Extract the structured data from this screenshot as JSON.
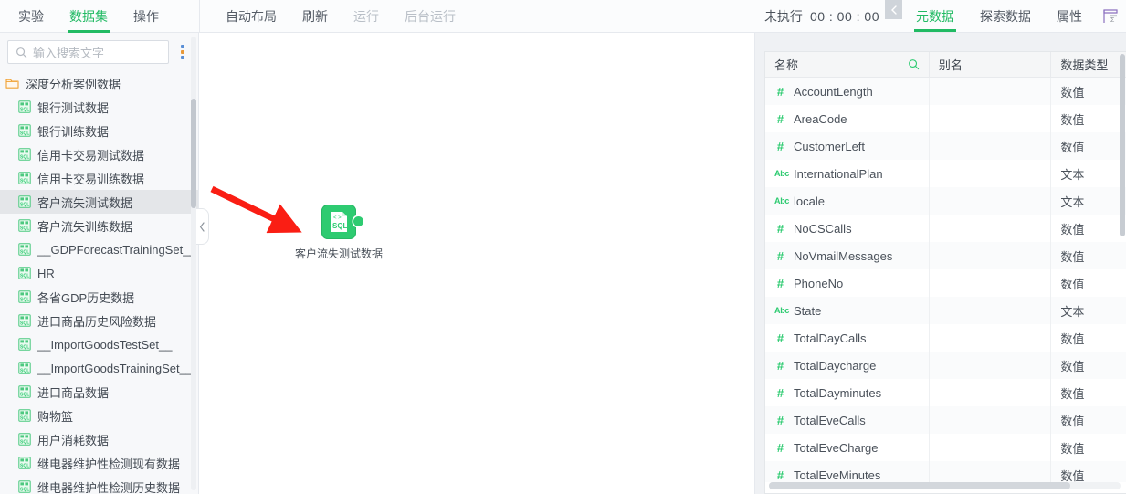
{
  "topbar": {
    "left_tabs": [
      {
        "label": "实验",
        "active": false
      },
      {
        "label": "数据集",
        "active": true
      },
      {
        "label": "操作",
        "active": false
      }
    ],
    "actions": [
      {
        "label": "自动布局",
        "disabled": false
      },
      {
        "label": "刷新",
        "disabled": false
      },
      {
        "label": "运行",
        "disabled": true
      },
      {
        "label": "后台运行",
        "disabled": true
      }
    ],
    "run_status": "未执行",
    "run_timer": "00 : 00 : 00",
    "collapse_icon": "chevron-left-icon",
    "right_tabs": [
      {
        "label": "元数据",
        "active": true
      },
      {
        "label": "探索数据",
        "active": false
      },
      {
        "label": "属性",
        "active": false
      }
    ],
    "grid_icon": "table-summary-icon"
  },
  "sidebar": {
    "search": {
      "placeholder": "输入搜索文字",
      "value": "",
      "icon": "search-icon"
    },
    "more_icon": "more-vertical-icon",
    "folder": {
      "label": "深度分析案例数据",
      "icon": "folder-icon"
    },
    "items": [
      {
        "label": "银行测试数据",
        "icon": "sql-dataset-icon",
        "selected": false
      },
      {
        "label": "银行训练数据",
        "icon": "sql-dataset-icon",
        "selected": false
      },
      {
        "label": "信用卡交易测试数据",
        "icon": "sql-dataset-icon",
        "selected": false
      },
      {
        "label": "信用卡交易训练数据",
        "icon": "sql-dataset-icon",
        "selected": false
      },
      {
        "label": "客户流失测试数据",
        "icon": "sql-dataset-icon",
        "selected": true
      },
      {
        "label": "客户流失训练数据",
        "icon": "sql-dataset-icon",
        "selected": false
      },
      {
        "label": "__GDPForecastTrainingSet__",
        "icon": "sql-dataset-icon",
        "selected": false
      },
      {
        "label": "HR",
        "icon": "sql-dataset-icon",
        "selected": false
      },
      {
        "label": "各省GDP历史数据",
        "icon": "sql-dataset-icon",
        "selected": false
      },
      {
        "label": "进口商品历史风险数据",
        "icon": "sql-dataset-icon",
        "selected": false
      },
      {
        "label": "__ImportGoodsTestSet__",
        "icon": "sql-dataset-icon",
        "selected": false
      },
      {
        "label": "__ImportGoodsTrainingSet__",
        "icon": "sql-dataset-icon",
        "selected": false
      },
      {
        "label": "进口商品数据",
        "icon": "sql-dataset-icon",
        "selected": false
      },
      {
        "label": "购物篮",
        "icon": "sql-dataset-icon",
        "selected": false
      },
      {
        "label": "用户消耗数据",
        "icon": "sql-dataset-icon",
        "selected": false
      },
      {
        "label": "继电器维护性检测现有数据",
        "icon": "sql-dataset-icon",
        "selected": false
      },
      {
        "label": "继电器维护性检测历史数据",
        "icon": "sql-dataset-icon",
        "selected": false
      }
    ],
    "collapse_handle_icon": "chevron-left-icon"
  },
  "canvas": {
    "node": {
      "label": "客户流失测试数据",
      "icon": "sql-node-icon",
      "port_icon": "output-port-icon"
    },
    "annotation": {
      "type": "red-arrow",
      "color": "#fa1e14"
    }
  },
  "metadata_table": {
    "columns": [
      "名称",
      "别名",
      "数据类型"
    ],
    "name_search_icon": "search-icon",
    "rows": [
      {
        "name": "AccountLength",
        "alias": "",
        "type": "数值",
        "type_icon": "number-type-icon"
      },
      {
        "name": "AreaCode",
        "alias": "",
        "type": "数值",
        "type_icon": "number-type-icon"
      },
      {
        "name": "CustomerLeft",
        "alias": "",
        "type": "数值",
        "type_icon": "number-type-icon"
      },
      {
        "name": "InternationalPlan",
        "alias": "",
        "type": "文本",
        "type_icon": "text-type-icon"
      },
      {
        "name": "locale",
        "alias": "",
        "type": "文本",
        "type_icon": "text-type-icon"
      },
      {
        "name": "NoCSCalls",
        "alias": "",
        "type": "数值",
        "type_icon": "number-type-icon"
      },
      {
        "name": "NoVmailMessages",
        "alias": "",
        "type": "数值",
        "type_icon": "number-type-icon"
      },
      {
        "name": "PhoneNo",
        "alias": "",
        "type": "数值",
        "type_icon": "number-type-icon"
      },
      {
        "name": "State",
        "alias": "",
        "type": "文本",
        "type_icon": "text-type-icon"
      },
      {
        "name": "TotalDayCalls",
        "alias": "",
        "type": "数值",
        "type_icon": "number-type-icon"
      },
      {
        "name": "TotalDaycharge",
        "alias": "",
        "type": "数值",
        "type_icon": "number-type-icon"
      },
      {
        "name": "TotalDayminutes",
        "alias": "",
        "type": "数值",
        "type_icon": "number-type-icon"
      },
      {
        "name": "TotalEveCalls",
        "alias": "",
        "type": "数值",
        "type_icon": "number-type-icon"
      },
      {
        "name": "TotalEveCharge",
        "alias": "",
        "type": "数值",
        "type_icon": "number-type-icon"
      },
      {
        "name": "TotalEveMinutes",
        "alias": "",
        "type": "数值",
        "type_icon": "number-type-icon"
      }
    ]
  },
  "colors": {
    "accent_green": "#21ba63",
    "node_green": "#2ecb71",
    "arrow_red": "#fa1e14",
    "selected_row": "#e4e6e9"
  }
}
